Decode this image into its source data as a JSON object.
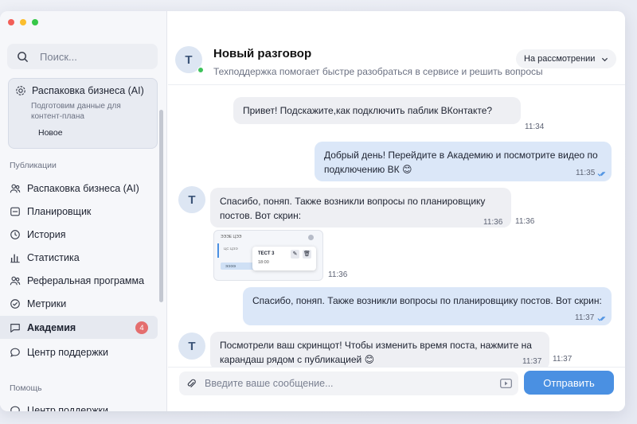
{
  "window": {
    "traffic_lights": [
      "#f25f58",
      "#fbbe2e",
      "#37c748"
    ]
  },
  "sidebar": {
    "search_placeholder": "Поиск...",
    "active_chat": {
      "title": "Распаковка бизнеса (AI)",
      "subtitle": "Подготовим данные для контент-плана",
      "status": "Новое"
    },
    "section_publications": "Публикации",
    "items": [
      {
        "label": "Распаковка бизнеса (AI)",
        "icon": "users-icon"
      },
      {
        "label": "Планировщик",
        "icon": "calendar-icon"
      },
      {
        "label": "История",
        "icon": "clock-icon"
      },
      {
        "label": "Статистика",
        "icon": "bar-chart-icon"
      },
      {
        "label": "Реферальная программа",
        "icon": "users-icon"
      },
      {
        "label": "Метрики",
        "icon": "check-circle-icon"
      }
    ],
    "academy": {
      "label": "Академия",
      "badge": "4"
    },
    "support": {
      "label": "Центр поддержки"
    },
    "section_help": "Помощь",
    "help_item": "Центр поддержки"
  },
  "header": {
    "avatar_letter": "T",
    "title": "Новый разговор",
    "subtitle": "Техподдержка помогает быстре разобраться в сервисе и решить вопросы",
    "status": "На рассмотрении"
  },
  "messages": [
    {
      "direction": "out",
      "text": "Привет! Подскажите,как подключить паблик ВКонтакте?",
      "time": "11:34"
    },
    {
      "direction": "out",
      "text": "Добрый день! Перейдите в Академию и посмотрите видео по подключению ВК 😊",
      "time": "11:35"
    },
    {
      "direction": "in",
      "avatar": "T",
      "text": "Спасибо, поняп. Также возникли вопросы по планировщику постов. Вот скрин:",
      "time": "11:36",
      "time_outer": "11:36"
    },
    {
      "direction": "in",
      "type": "attachment",
      "time": "11:36",
      "preview": {
        "header": "ЭЭЭЕ ЦЭЭ",
        "left_item": "ЦС ЦЭЭ",
        "card_title": "ТЕСТ 3",
        "card_time": "18:00",
        "tag": "ЭЭЭЭ"
      }
    },
    {
      "direction": "out",
      "text": "Спасибо, поняп. Также возникли вопросы по планировщику постов. Вот скрин:",
      "time": "11:37"
    },
    {
      "direction": "in",
      "avatar": "T",
      "text": "Посмотрели ваш скринщот! Чтобы изменить время поста, нажмите на карандаш рядом с публикацией 😊",
      "time": "11:37",
      "time_outer": "11:37"
    }
  ],
  "composer": {
    "placeholder": "Введите ваше сообщение...",
    "send_label": "Отправить"
  },
  "colors": {
    "accent": "#4a90e2",
    "out_bubble": "#dbe7f8",
    "in_bubble": "#eeeff3",
    "badge": "#e46e6e",
    "online": "#3ec25a"
  }
}
